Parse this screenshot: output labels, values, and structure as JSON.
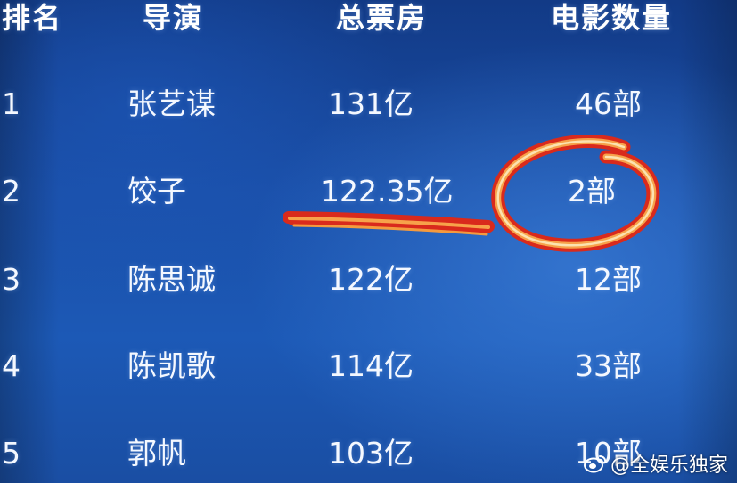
{
  "table": {
    "headers": [
      "排名",
      "导演",
      "总票房",
      "电影数量"
    ],
    "rows": [
      {
        "rank": "1",
        "director": "张艺谋",
        "box_office": "131亿",
        "films": "46部"
      },
      {
        "rank": "2",
        "director": "饺子",
        "box_office": "122.35亿",
        "films": "2部"
      },
      {
        "rank": "3",
        "director": "陈思诚",
        "box_office": "122亿",
        "films": "12部"
      },
      {
        "rank": "4",
        "director": "陈凯歌",
        "box_office": "114亿",
        "films": "33部"
      },
      {
        "rank": "5",
        "director": "郭帆",
        "box_office": "103亿",
        "films": "10部"
      }
    ]
  },
  "annotations": {
    "highlight_row": "2",
    "underline_target": "122.35亿",
    "circle_target": "2部",
    "stroke_colors": [
      "#d92a1c",
      "#f7a24a",
      "#fbe3b0"
    ]
  },
  "watermark": {
    "text": "@全娱乐独家",
    "icon": "weibo-icon"
  }
}
